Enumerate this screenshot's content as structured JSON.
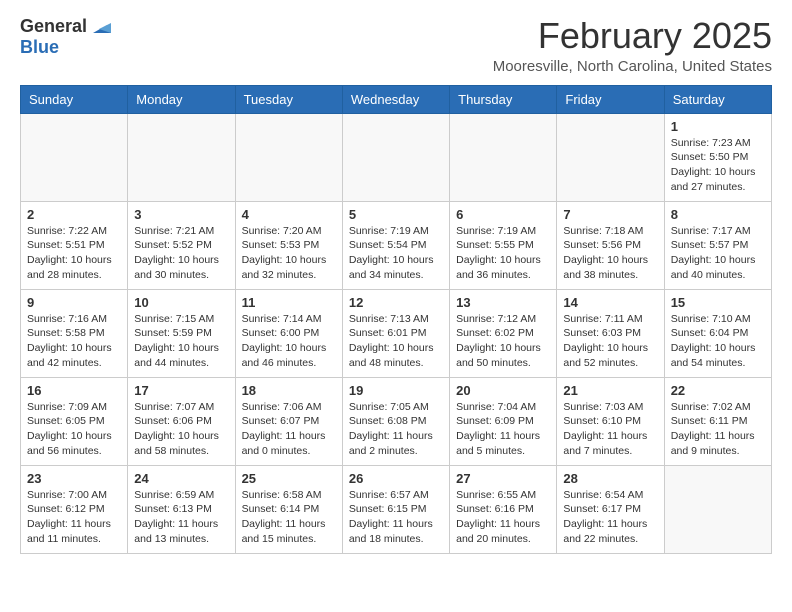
{
  "header": {
    "logo_general": "General",
    "logo_blue": "Blue",
    "month_title": "February 2025",
    "location": "Mooresville, North Carolina, United States"
  },
  "days_of_week": [
    "Sunday",
    "Monday",
    "Tuesday",
    "Wednesday",
    "Thursday",
    "Friday",
    "Saturday"
  ],
  "weeks": [
    [
      {
        "day": "",
        "info": ""
      },
      {
        "day": "",
        "info": ""
      },
      {
        "day": "",
        "info": ""
      },
      {
        "day": "",
        "info": ""
      },
      {
        "day": "",
        "info": ""
      },
      {
        "day": "",
        "info": ""
      },
      {
        "day": "1",
        "info": "Sunrise: 7:23 AM\nSunset: 5:50 PM\nDaylight: 10 hours and 27 minutes."
      }
    ],
    [
      {
        "day": "2",
        "info": "Sunrise: 7:22 AM\nSunset: 5:51 PM\nDaylight: 10 hours and 28 minutes."
      },
      {
        "day": "3",
        "info": "Sunrise: 7:21 AM\nSunset: 5:52 PM\nDaylight: 10 hours and 30 minutes."
      },
      {
        "day": "4",
        "info": "Sunrise: 7:20 AM\nSunset: 5:53 PM\nDaylight: 10 hours and 32 minutes."
      },
      {
        "day": "5",
        "info": "Sunrise: 7:19 AM\nSunset: 5:54 PM\nDaylight: 10 hours and 34 minutes."
      },
      {
        "day": "6",
        "info": "Sunrise: 7:19 AM\nSunset: 5:55 PM\nDaylight: 10 hours and 36 minutes."
      },
      {
        "day": "7",
        "info": "Sunrise: 7:18 AM\nSunset: 5:56 PM\nDaylight: 10 hours and 38 minutes."
      },
      {
        "day": "8",
        "info": "Sunrise: 7:17 AM\nSunset: 5:57 PM\nDaylight: 10 hours and 40 minutes."
      }
    ],
    [
      {
        "day": "9",
        "info": "Sunrise: 7:16 AM\nSunset: 5:58 PM\nDaylight: 10 hours and 42 minutes."
      },
      {
        "day": "10",
        "info": "Sunrise: 7:15 AM\nSunset: 5:59 PM\nDaylight: 10 hours and 44 minutes."
      },
      {
        "day": "11",
        "info": "Sunrise: 7:14 AM\nSunset: 6:00 PM\nDaylight: 10 hours and 46 minutes."
      },
      {
        "day": "12",
        "info": "Sunrise: 7:13 AM\nSunset: 6:01 PM\nDaylight: 10 hours and 48 minutes."
      },
      {
        "day": "13",
        "info": "Sunrise: 7:12 AM\nSunset: 6:02 PM\nDaylight: 10 hours and 50 minutes."
      },
      {
        "day": "14",
        "info": "Sunrise: 7:11 AM\nSunset: 6:03 PM\nDaylight: 10 hours and 52 minutes."
      },
      {
        "day": "15",
        "info": "Sunrise: 7:10 AM\nSunset: 6:04 PM\nDaylight: 10 hours and 54 minutes."
      }
    ],
    [
      {
        "day": "16",
        "info": "Sunrise: 7:09 AM\nSunset: 6:05 PM\nDaylight: 10 hours and 56 minutes."
      },
      {
        "day": "17",
        "info": "Sunrise: 7:07 AM\nSunset: 6:06 PM\nDaylight: 10 hours and 58 minutes."
      },
      {
        "day": "18",
        "info": "Sunrise: 7:06 AM\nSunset: 6:07 PM\nDaylight: 11 hours and 0 minutes."
      },
      {
        "day": "19",
        "info": "Sunrise: 7:05 AM\nSunset: 6:08 PM\nDaylight: 11 hours and 2 minutes."
      },
      {
        "day": "20",
        "info": "Sunrise: 7:04 AM\nSunset: 6:09 PM\nDaylight: 11 hours and 5 minutes."
      },
      {
        "day": "21",
        "info": "Sunrise: 7:03 AM\nSunset: 6:10 PM\nDaylight: 11 hours and 7 minutes."
      },
      {
        "day": "22",
        "info": "Sunrise: 7:02 AM\nSunset: 6:11 PM\nDaylight: 11 hours and 9 minutes."
      }
    ],
    [
      {
        "day": "23",
        "info": "Sunrise: 7:00 AM\nSunset: 6:12 PM\nDaylight: 11 hours and 11 minutes."
      },
      {
        "day": "24",
        "info": "Sunrise: 6:59 AM\nSunset: 6:13 PM\nDaylight: 11 hours and 13 minutes."
      },
      {
        "day": "25",
        "info": "Sunrise: 6:58 AM\nSunset: 6:14 PM\nDaylight: 11 hours and 15 minutes."
      },
      {
        "day": "26",
        "info": "Sunrise: 6:57 AM\nSunset: 6:15 PM\nDaylight: 11 hours and 18 minutes."
      },
      {
        "day": "27",
        "info": "Sunrise: 6:55 AM\nSunset: 6:16 PM\nDaylight: 11 hours and 20 minutes."
      },
      {
        "day": "28",
        "info": "Sunrise: 6:54 AM\nSunset: 6:17 PM\nDaylight: 11 hours and 22 minutes."
      },
      {
        "day": "",
        "info": ""
      }
    ]
  ]
}
